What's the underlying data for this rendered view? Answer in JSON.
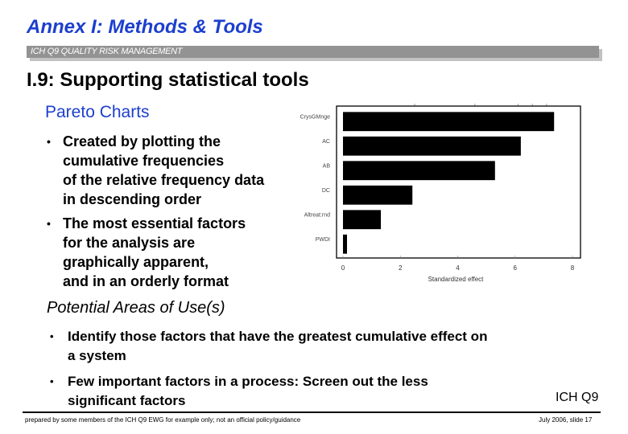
{
  "header": {
    "title": "Annex I: Methods & Tools",
    "banner": "ICH Q9 QUALITY RISK MANAGEMENT",
    "section_title": "I.9: Supporting statistical tools"
  },
  "pareto": {
    "subtitle": "Pareto Charts",
    "bullets": [
      {
        "lines": [
          "Created by plotting the",
          "cumulative frequencies",
          "of the relative frequency data",
          "in descending order"
        ]
      },
      {
        "lines": [
          "The most essential factors",
          "for the analysis are",
          "graphically apparent,",
          "and in an orderly format"
        ]
      }
    ]
  },
  "areas": {
    "title": "Potential Areas of Use(s)",
    "bullets": [
      {
        "lines": [
          "Identify those factors that have the greatest cumulative effect on",
          "a system"
        ]
      },
      {
        "lines": [
          "Few important factors in a process: Screen out the less",
          "significant factors"
        ]
      }
    ]
  },
  "bullet_glyph": "•",
  "ich_tag": "ICH Q9",
  "footer": {
    "left": "prepared by some members of the ICH Q9 EWG for example only; not an official policy/guidance",
    "right": "July 2006, slide 17"
  },
  "chart_data": {
    "type": "bar",
    "orientation": "horizontal",
    "title": "",
    "categories": [
      "CrysGMnge",
      "AC",
      "AB",
      "DC",
      "Altreat:rnd",
      "PWDI"
    ],
    "values": [
      7.36,
      6.2,
      5.3,
      2.42,
      1.32,
      0.14
    ],
    "xlabel": "Standardized effect",
    "ylabel": "",
    "xlim": [
      0,
      8
    ],
    "xticks": [
      0,
      2,
      4,
      6,
      8
    ],
    "xtick_labels": [
      "0",
      "2",
      "4",
      "6",
      "8"
    ],
    "top_minor_ticks": [
      2.5,
      4.6,
      6.1,
      6.6,
      7.1
    ],
    "bar_color": "#000000",
    "grid": false,
    "legend": "none"
  }
}
